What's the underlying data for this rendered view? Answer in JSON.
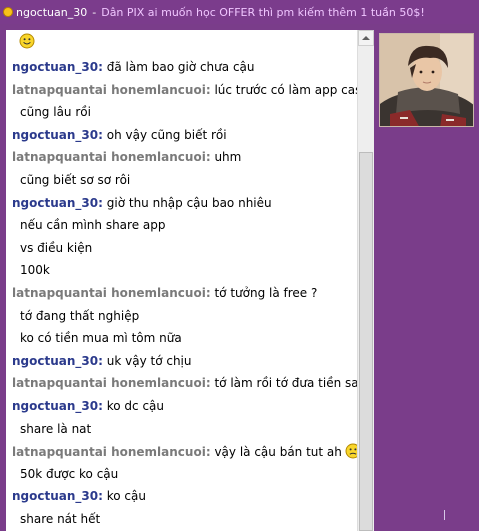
{
  "window": {
    "contact_name": "ngoctuan_30",
    "separator": "-",
    "status_message": "Dân PIX ai muốn học OFFER thì pm kiếm thêm 1 tuần 50$!"
  },
  "colors": {
    "frame": "#7a3d8a",
    "my_name": "#2b3a8c",
    "peer_name": "#7a7a7a",
    "status_dot": "#f7c21a"
  },
  "icons": {
    "top_smiley": "smiley-icon",
    "inline_smiley": "worried-smiley-icon"
  },
  "messages": [
    {
      "sender": "ngoctuan_30:",
      "who": "me",
      "lines": [
        "đã làm bao giờ chưa cậu"
      ]
    },
    {
      "sender": "latnapquantai honemlancuoi:",
      "who": "peer",
      "lines": [
        "lúc trước có làm app casher",
        "cũng lâu rồi"
      ]
    },
    {
      "sender": "ngoctuan_30:",
      "who": "me",
      "lines": [
        "oh vậy cũng biết rồi"
      ]
    },
    {
      "sender": "latnapquantai honemlancuoi:",
      "who": "peer",
      "lines": [
        "uhm",
        "cũng biết sơ sơ rôi"
      ]
    },
    {
      "sender": "ngoctuan_30:",
      "who": "me",
      "lines": [
        "giờ thu nhập cậu bao nhiêu",
        "nếu cần mình share app",
        "vs điều kiện",
        "100k"
      ]
    },
    {
      "sender": "latnapquantai honemlancuoi:",
      "who": "peer",
      "lines": [
        "tớ tưởng là free ?",
        "tớ đang thất nghiệp",
        "ko có tiền mua mì tôm nữa"
      ]
    },
    {
      "sender": "ngoctuan_30:",
      "who": "me",
      "lines": [
        "uk vậy tớ chịu"
      ]
    },
    {
      "sender": "latnapquantai honemlancuoi:",
      "who": "peer",
      "lines": [
        "tớ làm rồi tớ đưa tiền sau"
      ]
    },
    {
      "sender": "ngoctuan_30:",
      "who": "me",
      "lines": [
        "ko dc cậu",
        "share là nat"
      ]
    },
    {
      "sender": "latnapquantai honemlancuoi:",
      "who": "peer",
      "lines": [
        "vậy là cậu bán tut ah",
        "50k được ko cậu"
      ],
      "smiley_after_line": 0
    },
    {
      "sender": "ngoctuan_30:",
      "who": "me",
      "lines": [
        "ko cậu",
        "share nát hết"
      ]
    }
  ]
}
